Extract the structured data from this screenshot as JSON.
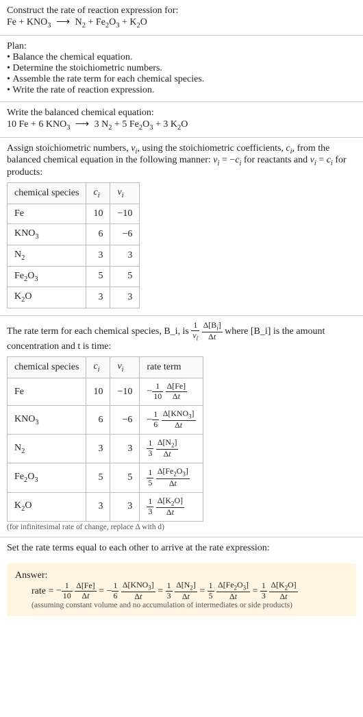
{
  "prompt": {
    "line1": "Construct the rate of reaction expression for:",
    "equation": "Fe + KNO_3 ⟶ N_2 + Fe_2O_3 + K_2O"
  },
  "plan": {
    "heading": "Plan:",
    "items": [
      "Balance the chemical equation.",
      "Determine the stoichiometric numbers.",
      "Assemble the rate term for each chemical species.",
      "Write the rate of reaction expression."
    ]
  },
  "balanced": {
    "heading": "Write the balanced chemical equation:",
    "equation": "10 Fe + 6 KNO_3 ⟶ 3 N_2 + 5 Fe_2O_3 + 3 K_2O"
  },
  "stoich": {
    "intro": "Assign stoichiometric numbers, ν_i, using the stoichiometric coefficients, c_i, from the balanced chemical equation in the following manner: ν_i = −c_i for reactants and ν_i = c_i for products:",
    "headers": [
      "chemical species",
      "c_i",
      "ν_i"
    ],
    "rows": [
      {
        "species": "Fe",
        "c": "10",
        "nu": "−10"
      },
      {
        "species": "KNO_3",
        "c": "6",
        "nu": "−6"
      },
      {
        "species": "N_2",
        "c": "3",
        "nu": "3"
      },
      {
        "species": "Fe_2O_3",
        "c": "5",
        "nu": "5"
      },
      {
        "species": "K_2O",
        "c": "3",
        "nu": "3"
      }
    ]
  },
  "rateterm": {
    "intro_pre": "The rate term for each chemical species, B_i, is ",
    "intro_post": " where [B_i] is the amount concentration and t is time:",
    "headers": [
      "chemical species",
      "c_i",
      "ν_i",
      "rate term"
    ],
    "rows": [
      {
        "species": "Fe",
        "c": "10",
        "nu": "−10",
        "sign": "−",
        "coef_top": "1",
        "coef_bot": "10",
        "delta": "Δ[Fe]"
      },
      {
        "species": "KNO_3",
        "c": "6",
        "nu": "−6",
        "sign": "−",
        "coef_top": "1",
        "coef_bot": "6",
        "delta": "Δ[KNO_3]"
      },
      {
        "species": "N_2",
        "c": "3",
        "nu": "3",
        "sign": "",
        "coef_top": "1",
        "coef_bot": "3",
        "delta": "Δ[N_2]"
      },
      {
        "species": "Fe_2O_3",
        "c": "5",
        "nu": "5",
        "sign": "",
        "coef_top": "1",
        "coef_bot": "5",
        "delta": "Δ[Fe_2O_3]"
      },
      {
        "species": "K_2O",
        "c": "3",
        "nu": "3",
        "sign": "",
        "coef_top": "1",
        "coef_bot": "3",
        "delta": "Δ[K_2O]"
      }
    ],
    "note": "(for infinitesimal rate of change, replace Δ with d)"
  },
  "final": {
    "heading": "Set the rate terms equal to each other to arrive at the rate expression:"
  },
  "answer": {
    "label": "Answer:",
    "prefix": "rate = ",
    "terms": [
      {
        "sign": "−",
        "coef_top": "1",
        "coef_bot": "10",
        "delta": "Δ[Fe]"
      },
      {
        "sign": "−",
        "coef_top": "1",
        "coef_bot": "6",
        "delta": "Δ[KNO_3]"
      },
      {
        "sign": "",
        "coef_top": "1",
        "coef_bot": "3",
        "delta": "Δ[N_2]"
      },
      {
        "sign": "",
        "coef_top": "1",
        "coef_bot": "5",
        "delta": "Δ[Fe_2O_3]"
      },
      {
        "sign": "",
        "coef_top": "1",
        "coef_bot": "3",
        "delta": "Δ[K_2O]"
      }
    ],
    "assumption": "(assuming constant volume and no accumulation of intermediates or side products)"
  },
  "chart_data": {
    "type": "table",
    "tables": [
      {
        "title": "Stoichiometric numbers",
        "columns": [
          "chemical species",
          "c_i",
          "nu_i"
        ],
        "rows": [
          [
            "Fe",
            10,
            -10
          ],
          [
            "KNO3",
            6,
            -6
          ],
          [
            "N2",
            3,
            3
          ],
          [
            "Fe2O3",
            5,
            5
          ],
          [
            "K2O",
            3,
            3
          ]
        ]
      },
      {
        "title": "Rate terms",
        "columns": [
          "chemical species",
          "c_i",
          "nu_i",
          "rate term"
        ],
        "rows": [
          [
            "Fe",
            10,
            -10,
            "-(1/10) d[Fe]/dt"
          ],
          [
            "KNO3",
            6,
            -6,
            "-(1/6) d[KNO3]/dt"
          ],
          [
            "N2",
            3,
            3,
            "(1/3) d[N2]/dt"
          ],
          [
            "Fe2O3",
            5,
            5,
            "(1/5) d[Fe2O3]/dt"
          ],
          [
            "K2O",
            3,
            3,
            "(1/3) d[K2O]/dt"
          ]
        ]
      }
    ],
    "balanced_equation": "10 Fe + 6 KNO3 -> 3 N2 + 5 Fe2O3 + 3 K2O",
    "rate_expression": "rate = -(1/10) d[Fe]/dt = -(1/6) d[KNO3]/dt = (1/3) d[N2]/dt = (1/5) d[Fe2O3]/dt = (1/3) d[K2O]/dt"
  }
}
